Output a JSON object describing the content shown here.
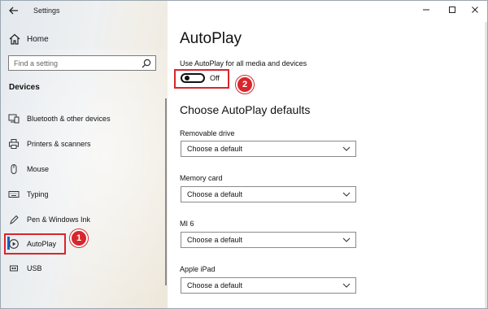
{
  "window": {
    "title": "Settings"
  },
  "sidebar": {
    "home_label": "Home",
    "search_placeholder": "Find a setting",
    "section": "Devices",
    "items": [
      {
        "label": "Bluetooth & other devices",
        "icon": "bluetooth-devices-icon"
      },
      {
        "label": "Printers & scanners",
        "icon": "printer-icon"
      },
      {
        "label": "Mouse",
        "icon": "mouse-icon"
      },
      {
        "label": "Typing",
        "icon": "keyboard-icon"
      },
      {
        "label": "Pen & Windows Ink",
        "icon": "pen-icon"
      },
      {
        "label": "AutoPlay",
        "icon": "autoplay-icon",
        "selected": true
      },
      {
        "label": "USB",
        "icon": "usb-icon"
      }
    ]
  },
  "annotations": {
    "badge1": "1",
    "badge2": "2",
    "color": "#d8262c"
  },
  "main": {
    "title": "AutoPlay",
    "toggle_label": "Use AutoPlay for all media and devices",
    "toggle_state": "Off",
    "defaults_title": "Choose AutoPlay defaults",
    "devices": [
      {
        "label": "Removable drive",
        "value": "Choose a default"
      },
      {
        "label": "Memory card",
        "value": "Choose a default"
      },
      {
        "label": "MI 6",
        "value": "Choose a default"
      },
      {
        "label": "Apple iPad",
        "value": "Choose a default"
      }
    ]
  },
  "colors": {
    "accent": "#1f5fbf",
    "highlight": "#d8262c"
  }
}
